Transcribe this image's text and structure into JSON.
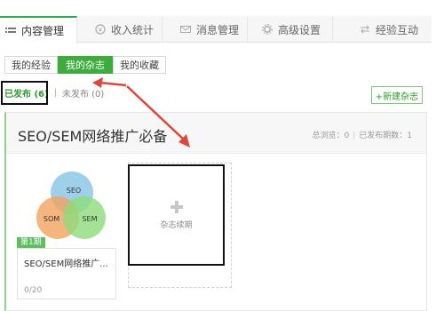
{
  "tabs": [
    {
      "label": "内容管理",
      "icon": "list-icon",
      "active": true
    },
    {
      "label": "收入统计",
      "icon": "coin-icon",
      "active": false
    },
    {
      "label": "消息管理",
      "icon": "mail-icon",
      "active": false
    },
    {
      "label": "高级设置",
      "icon": "gear-icon",
      "active": false
    },
    {
      "label": "经验互动",
      "icon": "swap-icon",
      "active": false
    }
  ],
  "subtabs": [
    {
      "label": "我的经验",
      "active": false
    },
    {
      "label": "我的杂志",
      "active": true
    },
    {
      "label": "我的收藏",
      "active": false
    }
  ],
  "status": {
    "published": "已发布 (6)",
    "unpublished": "未发布 (0)"
  },
  "new_magazine_button": "+新建杂志",
  "magazine": {
    "title": "SEO/SEM网络推广必备",
    "views": "总浏览：0",
    "issues": "已发布期数：1",
    "issue": {
      "badge": "第1期",
      "name": "SEO/SEM网络推广...",
      "count": "0/20",
      "cover_labels": [
        "SEO",
        "SOM",
        "SEM"
      ]
    },
    "add_issue_label": "杂志续期"
  },
  "colors": {
    "accent_green": "#3bad3b",
    "annotation_red": "#e0463a",
    "annotation_black": "#111111"
  }
}
